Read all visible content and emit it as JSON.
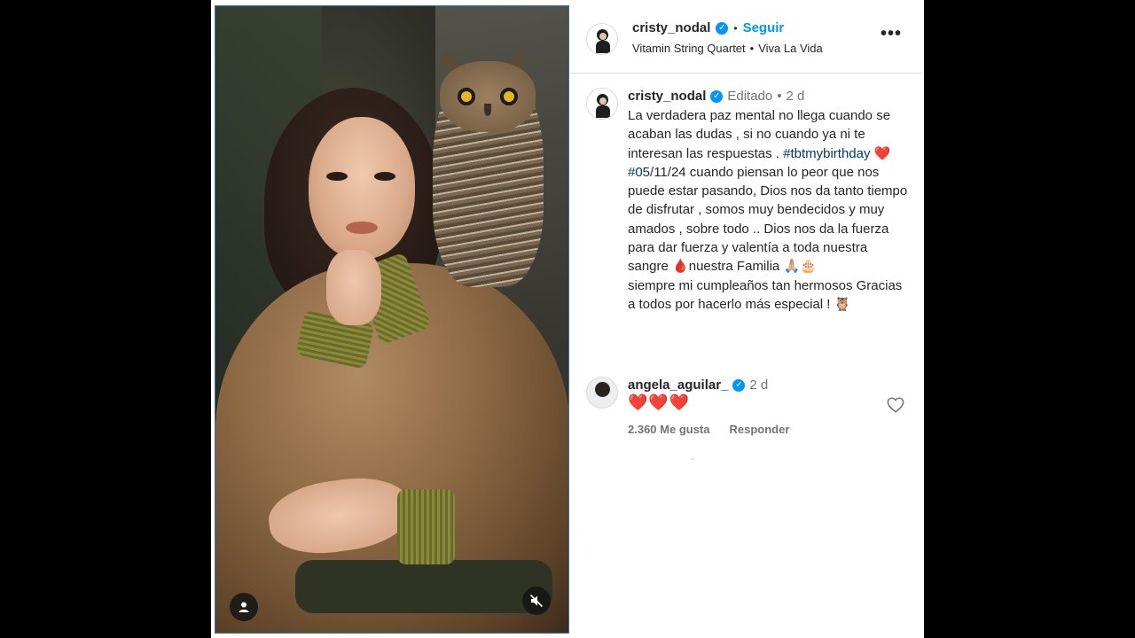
{
  "header": {
    "username": "cristy_nodal",
    "follow_label": "Seguir",
    "audio_artist": "Vitamin String Quartet",
    "audio_track": "Viva La Vida",
    "more_label": "•••"
  },
  "caption": {
    "username": "cristy_nodal",
    "edited_label": "Editado",
    "time": "2 d",
    "line1": "La verdadera paz mental no llega cuando se acaban las dudas , si no cuando ya ni te interesan las respuestas .",
    "hashtag": "#tbtmybirthday",
    "heart": "❤️",
    "line2a": "#05",
    "line2b": "/11/24 cuando piensan lo peor que nos puede estar pasando, Dios nos da tanto tiempo de disfrutar , somos muy bendecidos y muy amados , sobre todo .. Dios nos da la fuerza para dar fuerza y valentía a toda nuestra sangre ",
    "blood_drop": "🩸",
    "line3": "nuestra Familia ",
    "emoji_pray_cake": "🙏🏼🎂",
    "line4": "\nsiempre mi cumpleaños tan hermosos Gracias a todos por hacerlo más especial ! ",
    "emoji_owl": "🦉"
  },
  "comment": {
    "username": "angela_aguilar_",
    "time": "2 d",
    "text": "❤️❤️❤️",
    "likes": "2.360 Me gusta",
    "reply_label": "Responder"
  },
  "icons": {
    "verified": "verified-badge-icon",
    "user_tag": "user-tag-icon",
    "mute": "mute-icon",
    "like": "heart-outline-icon",
    "more": "more-options-icon"
  },
  "colors": {
    "link_blue": "#0095f6",
    "hashtag": "#00376b",
    "muted_text": "#737373",
    "heart_red": "#e0242f"
  }
}
